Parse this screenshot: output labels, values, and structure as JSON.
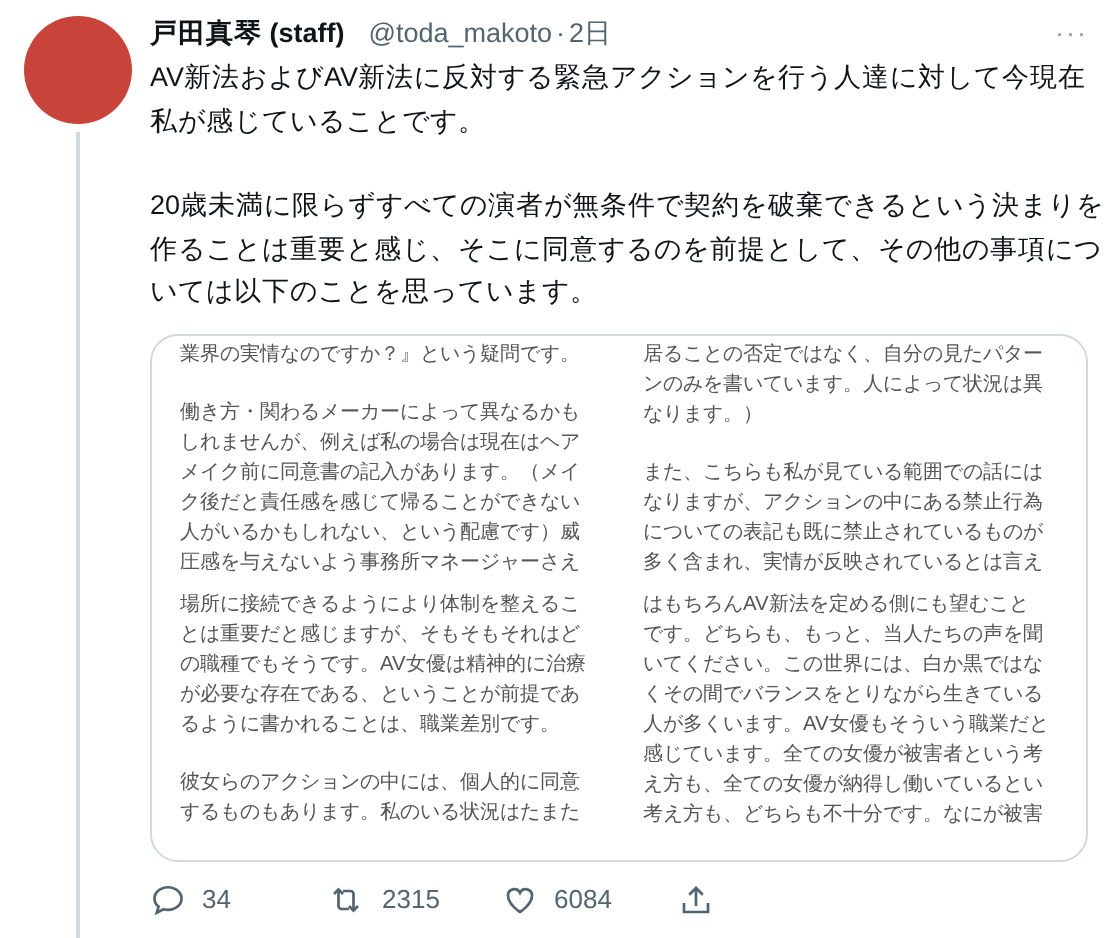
{
  "tweet": {
    "author": "戸田真琴 (staff)",
    "handle": "@toda_makoto",
    "separator": "·",
    "time": "2日",
    "more": "···",
    "text": [
      [
        "AV新法およびAV新法に反対する緊急アクションを行う人達に対して今現在",
        "私が感じていることです。"
      ],
      [
        "20歳未満に限らずすべての演者が無条件で契約を破棄できるという決まりを",
        "作ることは重要と感じ、そこに同意するのを前提として、その他の事項につ",
        "いては以下のことを思っています。"
      ]
    ],
    "image": {
      "columns": [
        {
          "snippets": [
            {
              "paragraphs": [
                [
                  "業界の実情なのですか？』という疑問です。"
                ],
                [
                  "働き方・関わるメーカーによって異なるかも",
                  "しれませんが、例えば私の場合は現在はヘア",
                  "メイク前に同意書の記入があります。（メイ",
                  "ク後だと責任感を感じて帰ることができない",
                  "人がいるかもしれない、という配慮です）威",
                  "圧感を与えないよう事務所マネージャーさえ"
                ]
              ]
            },
            {
              "paragraphs": [
                [
                  "場所に接続できるようにより体制を整えるこ",
                  "とは重要だと感じますが、そもそもそれはど",
                  "の職種でもそうです。AV女優は精神的に治療",
                  "が必要な存在である、ということが前提であ",
                  "るように書かれることは、職業差別です。"
                ],
                [
                  "彼女らのアクションの中には、個人的に同意",
                  "するものもあります。私のいる状況はたまた"
                ]
              ]
            }
          ]
        },
        {
          "snippets": [
            {
              "paragraphs": [
                [
                  "居ることの否定ではなく、自分の見たパター",
                  "ンのみを書いています。人によって状況は異",
                  "なります。）"
                ],
                [
                  "また、こちらも私が見ている範囲での話には",
                  "なりますが、アクションの中にある禁止行為",
                  "についての表記も既に禁止されているものが",
                  "多く含まれ、実情が反映されているとは言え"
                ]
              ]
            },
            {
              "paragraphs": [
                [
                  "はもちろんAV新法を定める側にも望むこと",
                  "です。どちらも、もっと、当人たちの声を聞",
                  "いてください。この世界には、白か黒ではな",
                  "くその間でバランスをとりながら生きている",
                  "人が多くいます。AV女優もそういう職業だと",
                  "感じています。全ての女優が被害者という考",
                  "え方も、全ての女優が納得し働いているとい",
                  "考え方も、どちらも不十分です。なにが被害"
                ]
              ]
            }
          ]
        }
      ]
    },
    "actions": [
      {
        "kind": "reply",
        "count": "34"
      },
      {
        "kind": "retweet",
        "count": "2315"
      },
      {
        "kind": "like",
        "count": "6084"
      },
      {
        "kind": "share"
      }
    ]
  }
}
